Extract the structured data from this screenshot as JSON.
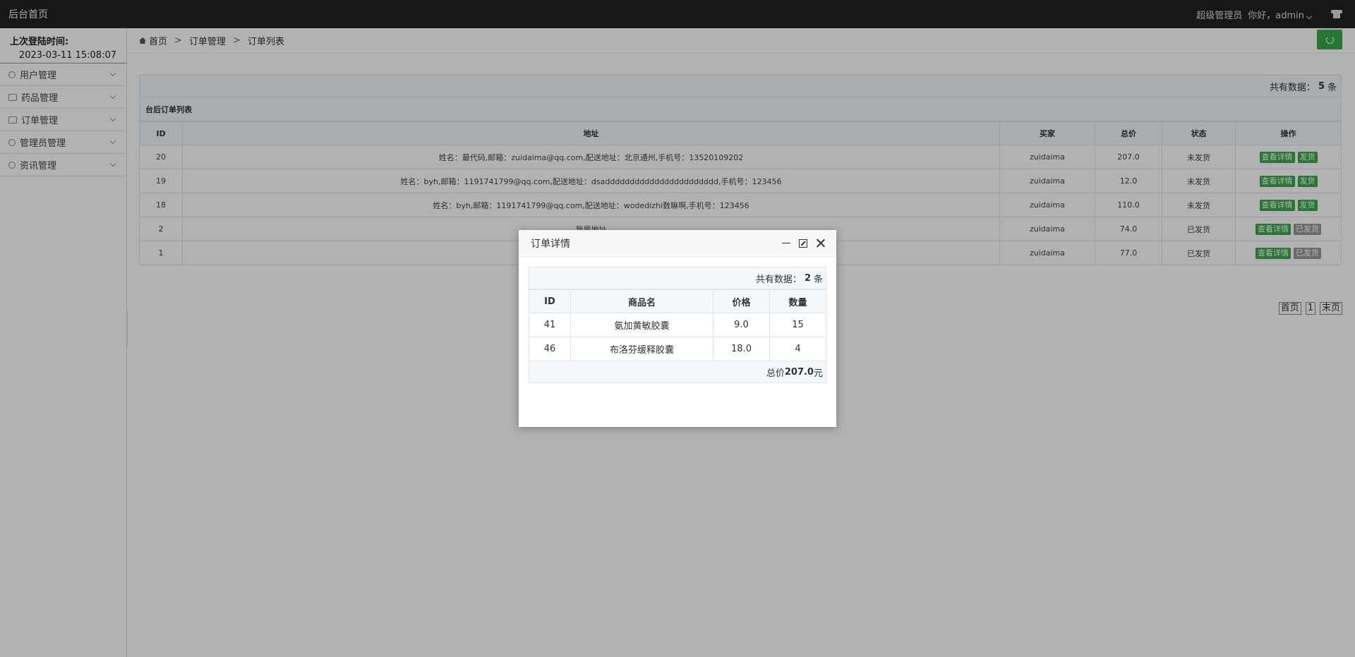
{
  "topbar": {
    "brand": "后台首页",
    "role": "超级管理员",
    "greeting": "你好，admin"
  },
  "sidebar": {
    "login_label": "上次登陆时间:",
    "login_time": "2023-03-11 15:08:07",
    "items": [
      {
        "label": "用户管理",
        "icon": "user-icon"
      },
      {
        "label": "药品管理",
        "icon": "bag-icon"
      },
      {
        "label": "订单管理",
        "icon": "card-icon"
      },
      {
        "label": "管理员管理",
        "icon": "admin-icon"
      },
      {
        "label": "资讯管理",
        "icon": "gear-icon"
      }
    ]
  },
  "breadcrumb": {
    "home": "首页",
    "sep": ">",
    "level1": "订单管理",
    "level2": "订单列表"
  },
  "orders": {
    "total_prefix": "共有数据：",
    "total_count": "5",
    "total_suffix": "条",
    "list_title": "台后订单列表",
    "columns": [
      "ID",
      "地址",
      "买家",
      "总价",
      "状态",
      "操作"
    ],
    "rows": [
      {
        "id": "20",
        "address": "姓名：最代码,邮箱：zuidaima@qq.com,配送地址：北京通州,手机号：13520109202",
        "buyer": "zuidaima",
        "total": "207.0",
        "status": "未发货",
        "view": "查看详情",
        "ship": "发货",
        "shipped": false
      },
      {
        "id": "19",
        "address": "姓名：byh,邮箱：1191741799@qq.com,配送地址：dsaddddddddddddddddddddddd,手机号：123456",
        "buyer": "zuidaima",
        "total": "12.0",
        "status": "未发货",
        "view": "查看详情",
        "ship": "发货",
        "shipped": false
      },
      {
        "id": "18",
        "address": "姓名：byh,邮箱：1191741799@qq.com,配送地址：wodedizhi数嘛啊,手机号：123456",
        "buyer": "zuidaima",
        "total": "110.0",
        "status": "未发货",
        "view": "查看详情",
        "ship": "发货",
        "shipped": false
      },
      {
        "id": "2",
        "address": "我是地址",
        "buyer": "zuidaima",
        "total": "74.0",
        "status": "已发货",
        "view": "查看详情",
        "ship": "已发货",
        "shipped": true
      },
      {
        "id": "1",
        "address": "",
        "buyer": "zuidaima",
        "total": "77.0",
        "status": "已发货",
        "view": "查看详情",
        "ship": "已发货",
        "shipped": true
      }
    ]
  },
  "pager": {
    "first": "首页",
    "current": "1",
    "last": "末页"
  },
  "modal": {
    "title": "订单详情",
    "total_prefix": "共有数据：",
    "total_count": "2",
    "total_suffix": "条",
    "columns": [
      "ID",
      "商品名",
      "价格",
      "数量"
    ],
    "rows": [
      {
        "id": "41",
        "name": "氨加黄敏胶囊",
        "price": "9.0",
        "qty": "15"
      },
      {
        "id": "46",
        "name": "布洛芬缓释胶囊",
        "price": "18.0",
        "qty": "4"
      }
    ],
    "sum_label": "总价",
    "sum_value": "207.0",
    "sum_unit": "元"
  },
  "colors": {
    "accent": "#3aa94a",
    "topbar": "#222222"
  }
}
